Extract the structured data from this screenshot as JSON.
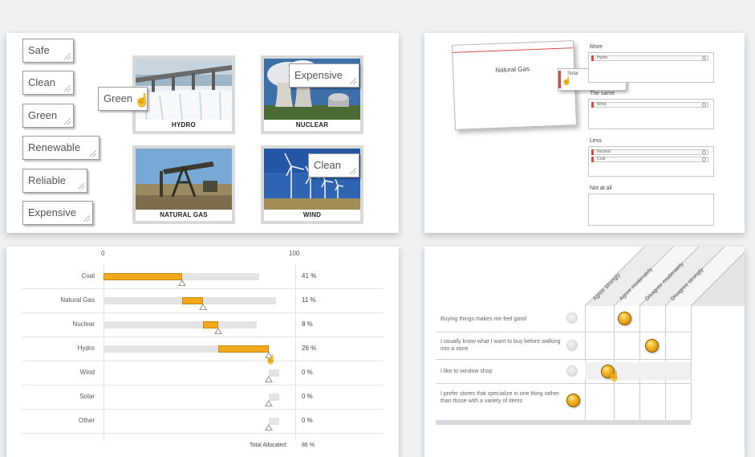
{
  "panel1": {
    "tags": [
      "Safe",
      "Clean",
      "Green",
      "Renewable",
      "Reliable",
      "Expensive"
    ],
    "dragging_tag": "Green",
    "tiles": [
      {
        "caption": "HYDRO",
        "tag": ""
      },
      {
        "caption": "NUCLEAR",
        "tag": "Expensive"
      },
      {
        "caption": "NATURAL GAS",
        "tag": ""
      },
      {
        "caption": "WIND",
        "tag": "Clean"
      }
    ]
  },
  "panel2": {
    "card_label": "Natural Gas",
    "dragging_item": "Solar",
    "lists": [
      {
        "label": "More",
        "items": [
          "Hydro"
        ]
      },
      {
        "label": "The same",
        "items": [
          "Wind"
        ]
      },
      {
        "label": "Less",
        "items": [
          "Nuclear",
          "Coal"
        ]
      },
      {
        "label": "Not at all",
        "items": []
      }
    ]
  },
  "panel3": {
    "scale_min": "0",
    "scale_max": "100",
    "unit": "%",
    "total_label": "Total Allocated:",
    "total_value": "86 %",
    "rows": [
      {
        "label": "Coal",
        "value": 41
      },
      {
        "label": "Natural Gas",
        "value": 11
      },
      {
        "label": "Nuclear",
        "value": 8
      },
      {
        "label": "Hydro",
        "value": 26
      },
      {
        "label": "Wind",
        "value": 0
      },
      {
        "label": "Solar",
        "value": 0
      },
      {
        "label": "Other",
        "value": 0
      }
    ]
  },
  "panel4": {
    "columns": [
      "Agree strongly",
      "Agree moderately",
      "Disagree moderately",
      "Disagree strongly"
    ],
    "statements": [
      {
        "text": "Buying things makes me feel good",
        "selected": 1
      },
      {
        "text": "I usually know what I want to buy before walking into a store",
        "selected": 2
      },
      {
        "text": "I like to window shop",
        "selected": 0
      },
      {
        "text": "I prefer stores that specialize in one thing rather than those with a variety of items",
        "selected": null
      }
    ]
  }
}
